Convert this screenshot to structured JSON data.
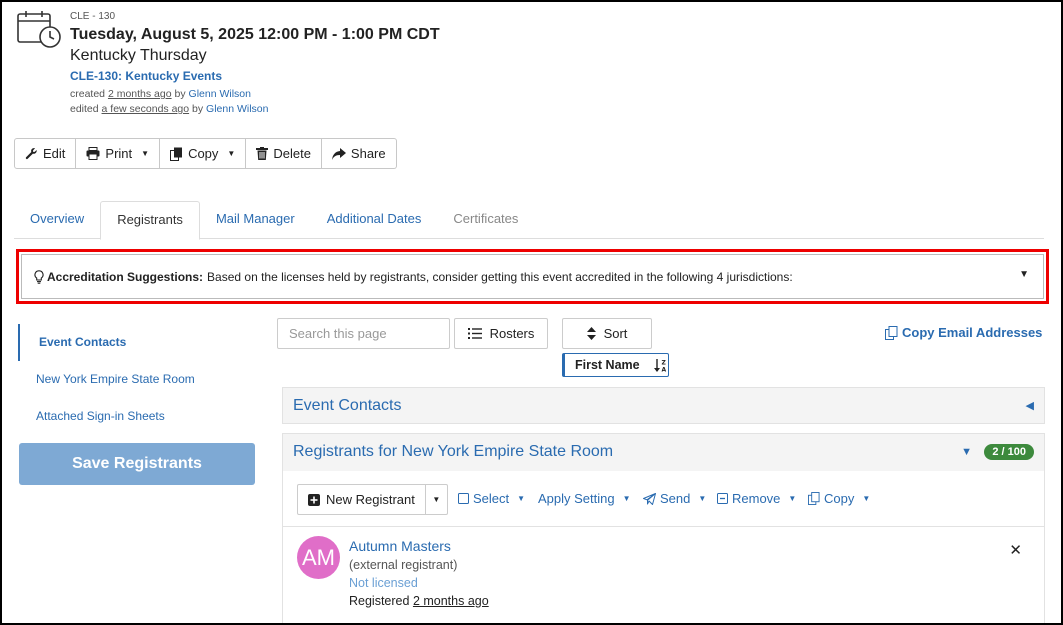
{
  "event": {
    "code": "CLE - 130",
    "datetime": "Tuesday, August 5, 2025 12:00 PM - 1:00 PM CDT",
    "name": "Kentucky Thursday",
    "program": "CLE-130: Kentucky Events",
    "created_prefix": "created",
    "created_ago": "2 months ago",
    "created_by_prefix": "by",
    "created_by": "Glenn Wilson",
    "edited_prefix": "edited",
    "edited_ago": "a few seconds ago",
    "edited_by_prefix": "by",
    "edited_by": "Glenn Wilson"
  },
  "actions": {
    "edit": "Edit",
    "print": "Print",
    "copy": "Copy",
    "delete": "Delete",
    "share": "Share"
  },
  "tabs": [
    "Overview",
    "Registrants",
    "Mail Manager",
    "Additional Dates",
    "Certificates"
  ],
  "accreditation": {
    "label": "Accreditation Suggestions:",
    "text": "Based on the licenses held by registrants, consider getting this event accredited in the following 4 jurisdictions:"
  },
  "leftnav": {
    "items": [
      "Event Contacts",
      "New York Empire State Room",
      "Attached Sign-in Sheets"
    ],
    "save": "Save Registrants"
  },
  "toolbar": {
    "search_placeholder": "Search this page",
    "rosters": "Rosters",
    "sort": "Sort",
    "copy_emails": "Copy Email Addresses",
    "sort_field": "First Name"
  },
  "panels": {
    "contacts_title": "Event Contacts",
    "registrants_title": "Registrants for New York Empire State Room",
    "registrants_badge": "2 / 100"
  },
  "regbar": {
    "new_registrant": "New Registrant",
    "select": "Select",
    "apply_setting": "Apply Setting",
    "send": "Send",
    "remove": "Remove",
    "copy": "Copy"
  },
  "registrant": {
    "initials": "AM",
    "name": "Autumn Masters",
    "type": "(external registrant)",
    "license": "Not licensed",
    "registered_prefix": "Registered",
    "registered_ago": "2 months ago"
  },
  "colors": {
    "link": "#2a6bb0",
    "highlight": "#ee0000",
    "save_button": "#7ea9d4",
    "badge": "#3d8a3d",
    "avatar": "#e06ec8"
  }
}
